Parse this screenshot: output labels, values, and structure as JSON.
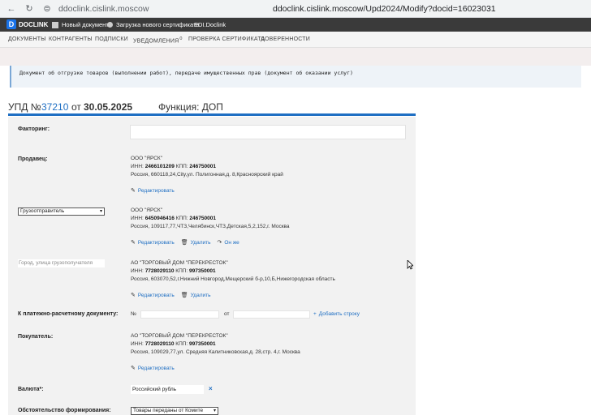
{
  "browser": {
    "url_short": "ddoclink.cislink.moscow",
    "url_full": "ddoclink.cislink.moscow/Upd2024/Modify?docid=16023031"
  },
  "appbar": {
    "logo_letter": "D",
    "logo_text": "DOCLINK",
    "new_doc": "Новый документ",
    "cert_upload": "Загрузка нового сертификата",
    "edi": "EDI.Doclink"
  },
  "menu": {
    "documents": "ДОКУМЕНТЫ",
    "contractors": "КОНТРАГЕНТЫ",
    "signatures": "ПОДПИСКИ",
    "notifications": "УВЕДОМЛЕНИЯ",
    "notifications_count": "0",
    "cert_check": "ПРОВЕРКА СЕРТИФИКАТА",
    "trust": "ДОВЕРЕННОСТИ"
  },
  "notice": "Документ об отгрузке товаров (выполнении работ), передаче имущественных прав (документ об оказании услуг)",
  "title": {
    "upd_prefix": "УПД №",
    "number": "37210",
    "from": "от",
    "date": "30.05.2025",
    "function": "Функция: ДОП"
  },
  "form": {
    "factoring_label": "Факторинг:",
    "seller_label": "Продавец:",
    "seller": {
      "name": "ООО \"ЯРСК\"",
      "inn_label": "ИНН:",
      "inn": "2466101209",
      "kpp_label": "КПП:",
      "kpp": "246750001",
      "address": "Россия, 660118,24,City,ул. Полигонная,д. 8,Красноярский край"
    },
    "edit": "Редактировать",
    "delete": "Удалить",
    "same": "Он же",
    "shipper_select": "Грузоотправитель",
    "shipper": {
      "name": "ООО \"ЯРСК\"",
      "inn_label": "ИНН:",
      "inn": "6450946416",
      "kpp_label": "КПП:",
      "kpp": "246750001",
      "address": "Россия, 109117,77,ЧТЗ,Челябинск,ЧТЗ,Детская,5,2,152,г. Москва"
    },
    "consignee_placeholder": "Город, улица грузополучателя",
    "consignee": {
      "name": "АО \"ТОРГОВЫЙ ДОМ \"ПЕРЕКРЕСТОК\"",
      "inn_label": "ИНН:",
      "inn": "7728029110",
      "kpp_label": "КПП:",
      "kpp": "997350001",
      "address": "Россия, 603070,52,г.Нижний Новгород,Мещерский б-р,10,Б,Нижегородская область"
    },
    "payment_label": "К платежно-расчетному документу:",
    "num_sign": "№",
    "from_word": "от",
    "add_row": "Добавить строку",
    "buyer_label": "Покупатель:",
    "buyer": {
      "name": "АО \"ТОРГОВЫЙ ДОМ \"ПЕРЕКРЕСТОК\"",
      "inn_label": "ИНН:",
      "inn": "7728029110",
      "kpp_label": "КПП:",
      "kpp": "997350001",
      "address": "Россия, 109029,77,ул. Средняя Калитниковская,д. 28,стр. 4,г. Москва"
    },
    "currency_label": "Валюта*:",
    "currency_value": "Российский рубль",
    "circ_label": "Обстоятельство формирования:",
    "circ_value": "Товары переданы от Комите"
  },
  "colors": {
    "accent": "#1f6fc3",
    "appbar": "#3a3a3a"
  }
}
